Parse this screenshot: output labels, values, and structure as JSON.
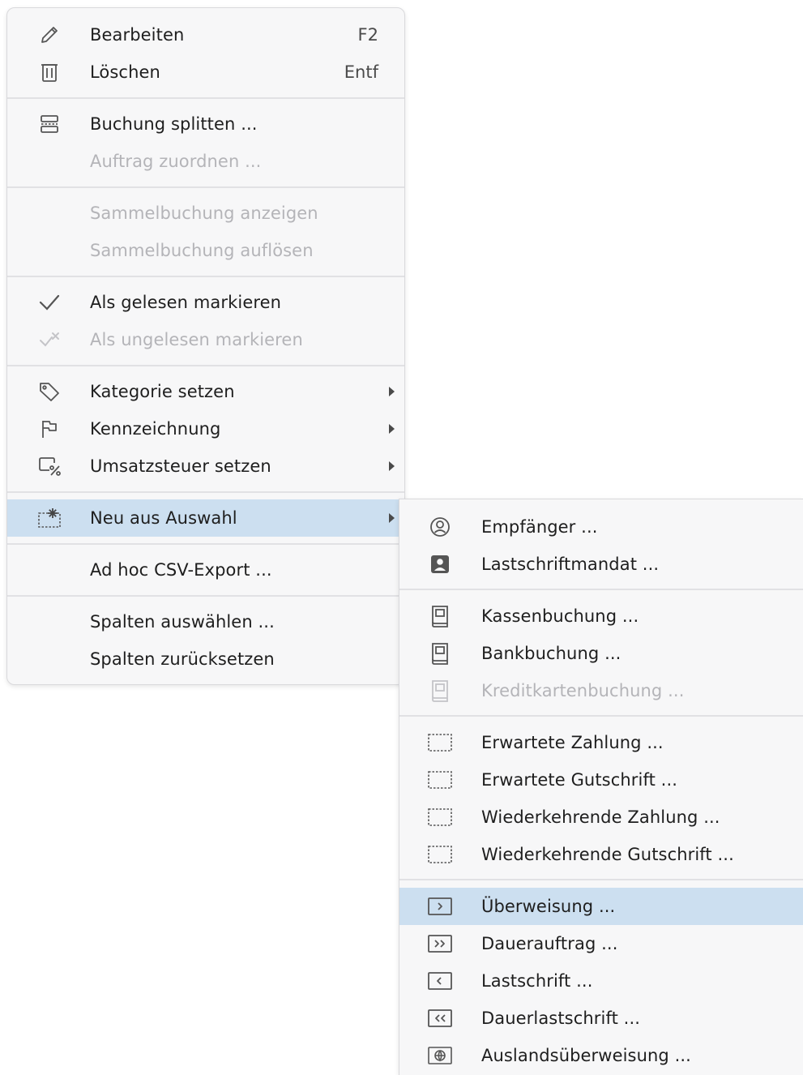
{
  "main_menu": {
    "items": [
      {
        "label": "Bearbeiten",
        "shortcut": "F2",
        "icon": "pencil-icon",
        "enabled": true
      },
      {
        "label": "Löschen",
        "shortcut": "Entf",
        "icon": "trash-icon",
        "enabled": true
      },
      {
        "label": "Buchung splitten ...",
        "icon": "split-icon",
        "enabled": true
      },
      {
        "label": "Auftrag zuordnen ...",
        "enabled": false
      },
      {
        "label": "Sammelbuchung anzeigen",
        "enabled": false
      },
      {
        "label": "Sammelbuchung auflösen",
        "enabled": false
      },
      {
        "label": "Als gelesen markieren",
        "icon": "checkmark-icon",
        "enabled": true
      },
      {
        "label": "Als ungelesen markieren",
        "icon": "uncheck-icon",
        "enabled": false
      },
      {
        "label": "Kategorie setzen",
        "icon": "tag-icon",
        "submenu": true,
        "enabled": true
      },
      {
        "label": "Kennzeichnung",
        "icon": "flag-icon",
        "submenu": true,
        "enabled": true
      },
      {
        "label": "Umsatzsteuer setzen",
        "icon": "tax-percent-icon",
        "submenu": true,
        "enabled": true
      },
      {
        "label": "Neu aus Auswahl",
        "icon": "new-from-selection-icon",
        "submenu": true,
        "enabled": true,
        "highlighted": true
      },
      {
        "label": "Ad hoc CSV-Export ...",
        "enabled": true
      },
      {
        "label": "Spalten auswählen ...",
        "enabled": true
      },
      {
        "label": "Spalten zurücksetzen",
        "enabled": true
      }
    ]
  },
  "submenu": {
    "items": [
      {
        "label": "Empfänger ...",
        "icon": "person-circle-icon",
        "enabled": true
      },
      {
        "label": "Lastschriftmandat ...",
        "icon": "mandate-icon",
        "enabled": true
      },
      {
        "label": "Kassenbuchung ...",
        "icon": "book-icon",
        "enabled": true
      },
      {
        "label": "Bankbuchung ...",
        "icon": "book-icon",
        "enabled": true
      },
      {
        "label": "Kreditkartenbuchung ...",
        "icon": "book-icon",
        "enabled": false
      },
      {
        "label": "Erwartete Zahlung ...",
        "icon": "dashed-box-icon",
        "enabled": true
      },
      {
        "label": "Erwartete Gutschrift ...",
        "icon": "dashed-box-icon",
        "enabled": true
      },
      {
        "label": "Wiederkehrende Zahlung ...",
        "icon": "dashed-box-icon",
        "enabled": true
      },
      {
        "label": "Wiederkehrende Gutschrift ...",
        "icon": "dashed-box-icon",
        "enabled": true
      },
      {
        "label": "Überweisung ...",
        "icon": "transfer-icon",
        "enabled": true,
        "highlighted": true
      },
      {
        "label": "Dauerauftrag ...",
        "icon": "standing-order-icon",
        "enabled": true
      },
      {
        "label": "Lastschrift ...",
        "icon": "direct-debit-icon",
        "enabled": true
      },
      {
        "label": "Dauerlastschrift ...",
        "icon": "recurring-debit-icon",
        "enabled": true
      },
      {
        "label": "Auslandsüberweisung ...",
        "icon": "foreign-transfer-icon",
        "enabled": true
      }
    ]
  }
}
